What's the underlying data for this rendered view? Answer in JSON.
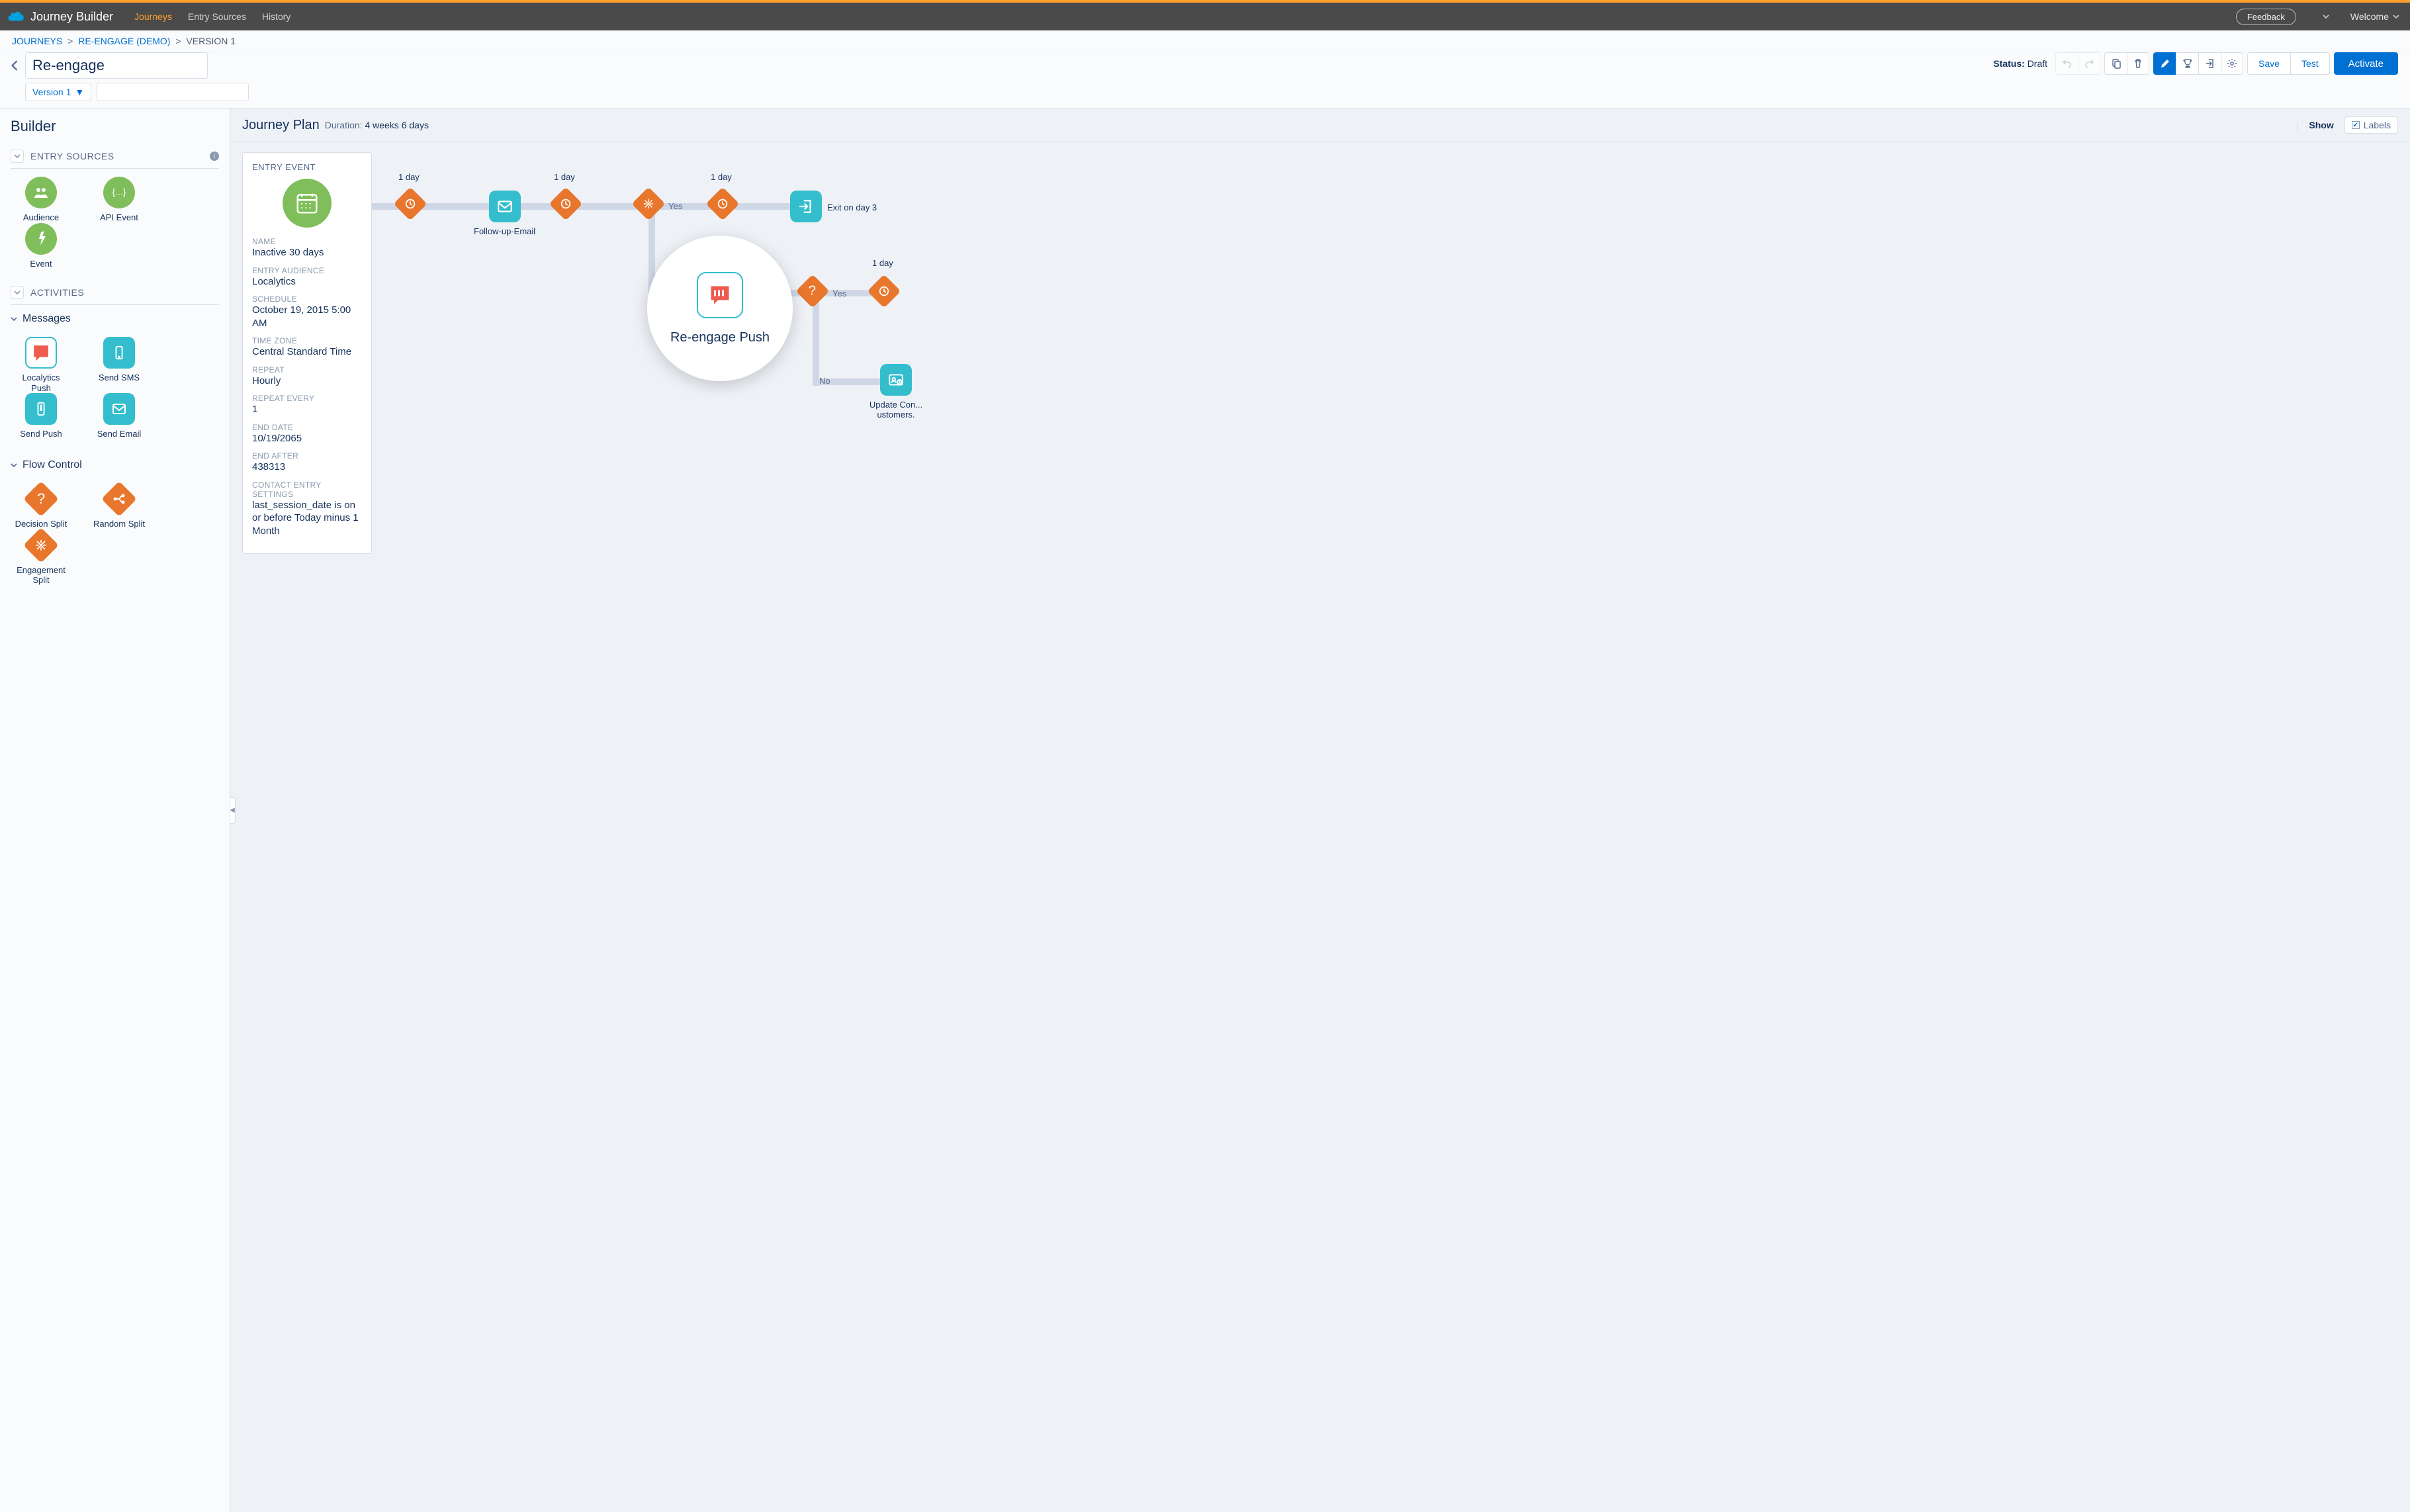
{
  "topbar": {
    "app_title": "Journey Builder",
    "nav": {
      "journeys": "Journeys",
      "entry_sources": "Entry Sources",
      "history": "History"
    },
    "feedback": "Feedback",
    "welcome": "Welcome"
  },
  "crumbs": {
    "journeys": "JOURNEYS",
    "demo": "RE-ENGAGE (DEMO)",
    "version": "VERSION 1"
  },
  "cmdbar": {
    "title_value": "Re-engage",
    "version": "Version 1",
    "status_label": "Status:",
    "status_value": "Draft",
    "save": "Save",
    "test": "Test",
    "activate": "Activate"
  },
  "sidebar": {
    "heading": "Builder",
    "entry_sources_title": "ENTRY SOURCES",
    "activities_title": "ACTIVITIES",
    "messages_title": "Messages",
    "flow_control_title": "Flow Control",
    "entry_sources": [
      {
        "label": "Audience"
      },
      {
        "label": "API Event"
      },
      {
        "label": "Event"
      }
    ],
    "messages": [
      {
        "label": "Localytics Push"
      },
      {
        "label": "Send SMS"
      },
      {
        "label": "Send Push"
      },
      {
        "label": "Send Email"
      }
    ],
    "flow_control": [
      {
        "label": "Decision Split"
      },
      {
        "label": "Random Split"
      },
      {
        "label": "Engagement Split"
      }
    ]
  },
  "plan": {
    "title": "Journey Plan",
    "duration_label": "Duration:",
    "duration_value": "4 weeks 6 days",
    "show": "Show",
    "labels": "Labels"
  },
  "entry_card": {
    "header": "ENTRY EVENT",
    "name_k": "NAME",
    "name_v": "Inactive 30 days",
    "aud_k": "ENTRY AUDIENCE",
    "aud_v": "Localytics",
    "sched_k": "SCHEDULE",
    "sched_v": "October 19, 2015 5:00 AM",
    "tz_k": "TIME ZONE",
    "tz_v": "Central Standard Time",
    "rep_k": "REPEAT",
    "rep_v": "Hourly",
    "repe_k": "REPEAT EVERY",
    "repe_v": "1",
    "end_k": "END DATE",
    "end_v": "10/19/2065",
    "enda_k": "END AFTER",
    "enda_v": "438313",
    "ces_k": "CONTACT ENTRY SETTINGS",
    "ces_v": "last_session_date is on or before Today minus 1 Month"
  },
  "canvas": {
    "wait_1": "1 day",
    "wait_2": "1 day",
    "wait_3": "1 day",
    "wait_4": "1 day",
    "email_label": "Follow-up-Email",
    "yes_a": "Yes",
    "yes_b": "Yes",
    "no_b": "No",
    "exit_label": "Exit on day 3",
    "bubble_label": "Re-engage Push",
    "update_label": "Update Con... ustomers."
  }
}
